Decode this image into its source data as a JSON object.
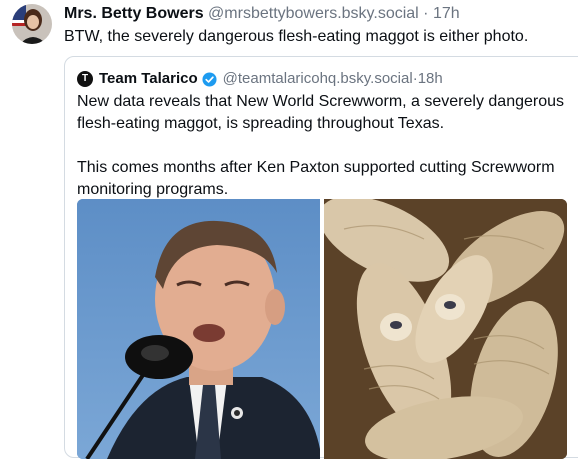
{
  "post": {
    "author_name": "Mrs. Betty Bowers",
    "handle": "@mrsbettybowers.bsky.social",
    "separator": "·",
    "time": "17h",
    "text": "BTW, the severely dangerous flesh-eating maggot is either photo."
  },
  "quote": {
    "avatar_letter": "T",
    "author_name": "Team Talarico",
    "handle": "@teamtalaricohq.bsky.social",
    "separator": "·",
    "time": "18h",
    "paragraph1": "New data reveals that New World Screwworm, a severely dangerous flesh-eating maggot, is spreading throughout Texas.",
    "paragraph2": "This comes months after Ken Paxton supported cutting Screwworm monitoring programs."
  },
  "colors": {
    "verified": "#1d9bf0",
    "muted": "#6b7480",
    "border": "#d4dbe2"
  },
  "icons": {
    "verified": "verified-badge-icon"
  }
}
